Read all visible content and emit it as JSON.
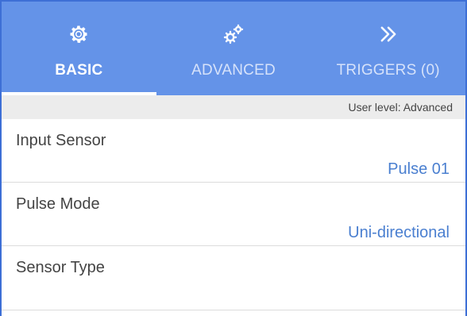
{
  "tabs": [
    {
      "label": "BASIC",
      "icon": "gear-icon",
      "active": true
    },
    {
      "label": "ADVANCED",
      "icon": "gears-icon",
      "active": false
    },
    {
      "label": "TRIGGERS (0)",
      "icon": "double-chevron-right-icon",
      "active": false
    }
  ],
  "user_level": "User level: Advanced",
  "settings": [
    {
      "label": "Input Sensor",
      "value": "Pulse 01"
    },
    {
      "label": "Pulse Mode",
      "value": "Uni-directional"
    },
    {
      "label": "Sensor Type",
      "value": ""
    }
  ],
  "colors": {
    "tab_bar": "#6493e8",
    "accent_value": "#4a7fd0",
    "frame_border": "#3d6fd6"
  }
}
